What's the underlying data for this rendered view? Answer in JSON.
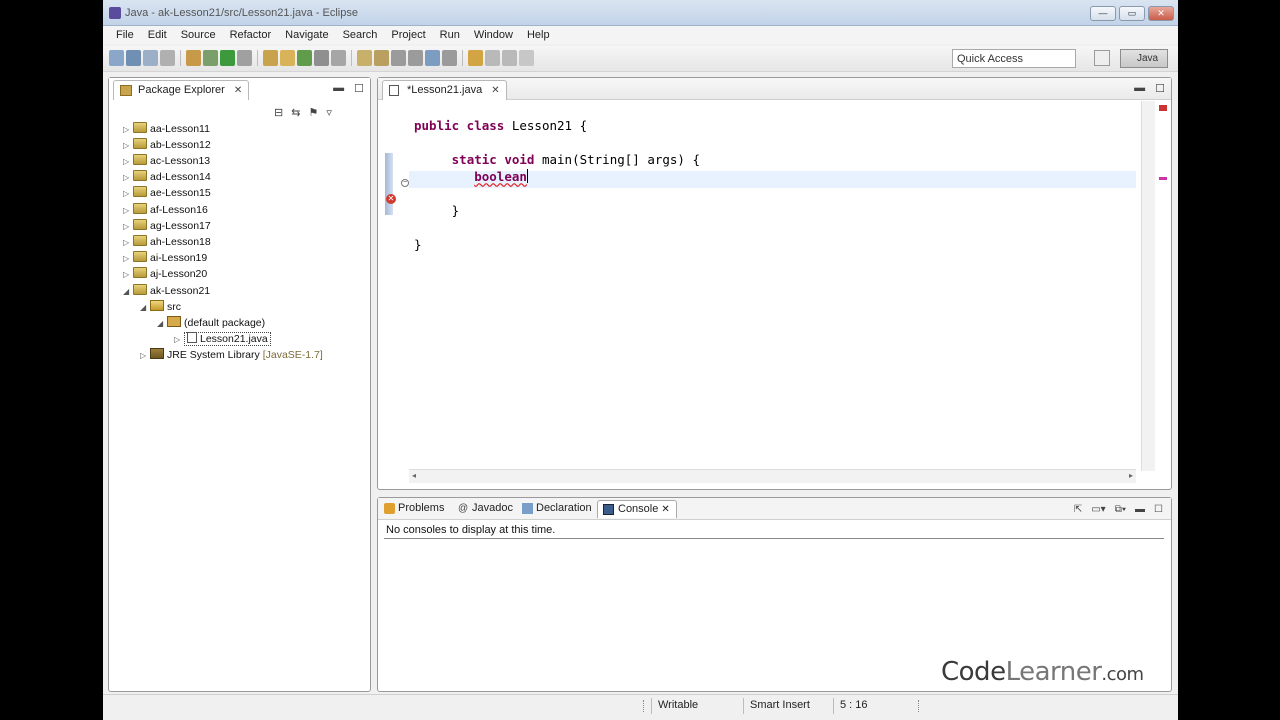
{
  "window": {
    "title": "Java - ak-Lesson21/src/Lesson21.java - Eclipse",
    "buttons": [
      "—",
      "▭",
      "✕"
    ]
  },
  "menu": [
    "File",
    "Edit",
    "Source",
    "Refactor",
    "Navigate",
    "Search",
    "Project",
    "Run",
    "Window",
    "Help"
  ],
  "toolbar": {
    "quick_access": "Quick Access",
    "perspective_label": "Java"
  },
  "package_explorer": {
    "title": "Package Explorer",
    "close": "✕",
    "projects": [
      "aa-Lesson11",
      "ab-Lesson12",
      "ac-Lesson13",
      "ad-Lesson14",
      "ae-Lesson15",
      "af-Lesson16",
      "ag-Lesson17",
      "ah-Lesson18",
      "ai-Lesson19",
      "aj-Lesson20",
      "ak-Lesson21"
    ],
    "src": "src",
    "package": "(default package)",
    "file": "Lesson21.java",
    "library": "JRE System Library",
    "library_version": "[JavaSE-1.7]"
  },
  "editor": {
    "tab_label": "*Lesson21.java",
    "tab_close": "✕",
    "code": {
      "l1_kw": "public class",
      "l1_rest": " Lesson21 {",
      "l3_kw": "static void",
      "l3_rest": " main(String[] args) {",
      "l4_word": "boolean",
      "l6": "}",
      "l8": "}"
    }
  },
  "bottom": {
    "tabs": [
      "Problems",
      "Javadoc",
      "Declaration",
      "Console"
    ],
    "console_close": "✕",
    "message": "No consoles to display at this time."
  },
  "status": {
    "mode": "Writable",
    "insert": "Smart Insert",
    "position": "5 : 16"
  },
  "watermark": {
    "a": "Code",
    "b": "Learner",
    "c": ".com"
  }
}
